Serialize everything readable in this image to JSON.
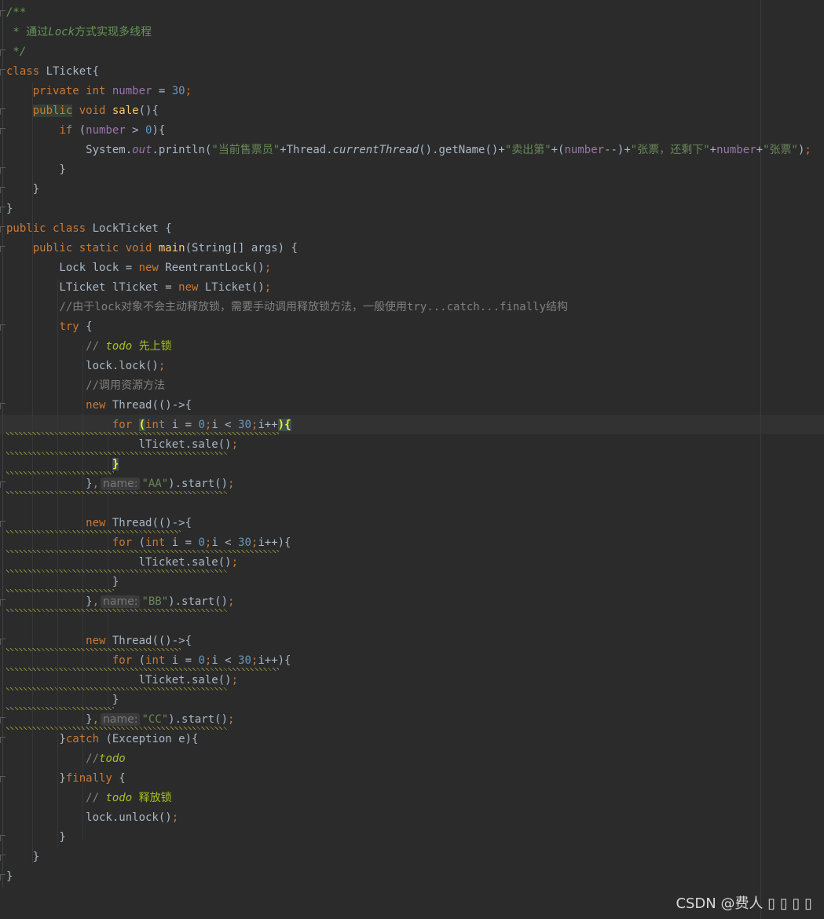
{
  "editor": {
    "lines": [
      {
        "parts": [
          [
            "doc",
            "/**"
          ]
        ]
      },
      {
        "parts": [
          [
            "docn",
            " * 通过"
          ],
          [
            "doc",
            "Lock"
          ],
          [
            "docn",
            "方式实现多线程"
          ]
        ]
      },
      {
        "parts": [
          [
            "doc",
            " */"
          ]
        ]
      },
      {
        "parts": [
          [
            "kw",
            "class "
          ],
          [
            "plain",
            "LTicket{"
          ]
        ]
      },
      {
        "parts": [
          [
            "plain",
            "    "
          ],
          [
            "kw",
            "private int "
          ],
          [
            "fld",
            "number"
          ],
          [
            "plain",
            " = "
          ],
          [
            "num",
            "30"
          ],
          [
            "kw",
            ";"
          ]
        ]
      },
      {
        "parts": [
          [
            "plain",
            "    "
          ],
          [
            "kwhl",
            "public"
          ],
          [
            "kw",
            " void "
          ],
          [
            "fn",
            "sale"
          ],
          [
            "plain",
            "(){"
          ]
        ]
      },
      {
        "parts": [
          [
            "plain",
            "        "
          ],
          [
            "kw",
            "if "
          ],
          [
            "plain",
            "("
          ],
          [
            "fld",
            "number"
          ],
          [
            "plain",
            " > "
          ],
          [
            "num",
            "0"
          ],
          [
            "plain",
            "){"
          ]
        ]
      },
      {
        "parts": [
          [
            "plain",
            "            System."
          ],
          [
            "fldi",
            "out"
          ],
          [
            "plain",
            ".println("
          ],
          [
            "str",
            "\"当前售票员\""
          ],
          [
            "plain",
            "+Thread."
          ],
          [
            "it",
            "currentThread"
          ],
          [
            "plain",
            "().getName()+"
          ],
          [
            "str",
            "\"卖出第\""
          ],
          [
            "plain",
            "+("
          ],
          [
            "fld",
            "number"
          ],
          [
            "plain",
            "--)+"
          ],
          [
            "str",
            "\"张票，还剩下\""
          ],
          [
            "plain",
            "+"
          ],
          [
            "fld",
            "number"
          ],
          [
            "plain",
            "+"
          ],
          [
            "str",
            "\"张票\""
          ],
          [
            "plain",
            ")"
          ],
          [
            "kw",
            ";"
          ]
        ]
      },
      {
        "parts": [
          [
            "plain",
            "        }"
          ]
        ]
      },
      {
        "parts": [
          [
            "plain",
            "    }"
          ]
        ]
      },
      {
        "parts": [
          [
            "plain",
            "}"
          ]
        ]
      },
      {
        "parts": [
          [
            "kw",
            "public class "
          ],
          [
            "plain",
            "LockTicket {"
          ]
        ]
      },
      {
        "parts": [
          [
            "plain",
            "    "
          ],
          [
            "kw",
            "public static void "
          ],
          [
            "fn",
            "main"
          ],
          [
            "plain",
            "(String[] args) {"
          ]
        ]
      },
      {
        "parts": [
          [
            "plain",
            "        Lock lock = "
          ],
          [
            "kw",
            "new "
          ],
          [
            "plain",
            "ReentrantLock()"
          ],
          [
            "kw",
            ";"
          ]
        ]
      },
      {
        "parts": [
          [
            "plain",
            "        LTicket lTicket = "
          ],
          [
            "kw",
            "new "
          ],
          [
            "plain",
            "LTicket()"
          ],
          [
            "kw",
            ";"
          ]
        ]
      },
      {
        "parts": [
          [
            "plain",
            "        "
          ],
          [
            "cm",
            "//由于lock对象不会主动释放锁，需要手动调用释放锁方法，一般使用try...catch...finally结构"
          ]
        ]
      },
      {
        "parts": [
          [
            "plain",
            "        "
          ],
          [
            "kw",
            "try "
          ],
          [
            "plain",
            "{"
          ]
        ]
      },
      {
        "parts": [
          [
            "plain",
            "            "
          ],
          [
            "cm",
            "// "
          ],
          [
            "todo",
            "todo"
          ],
          [
            "todot",
            " 先上锁"
          ]
        ]
      },
      {
        "parts": [
          [
            "plain",
            "            lock.lock()"
          ],
          [
            "kw",
            ";"
          ]
        ]
      },
      {
        "parts": [
          [
            "plain",
            "            "
          ],
          [
            "cm",
            "//调用资源方法"
          ]
        ]
      },
      {
        "parts": [
          [
            "plain",
            "            "
          ],
          [
            "kw",
            "new "
          ],
          [
            "plain",
            "Thread(()->{"
          ]
        ]
      },
      {
        "parts": [
          [
            "plain",
            "                "
          ],
          [
            "kw",
            "for "
          ],
          [
            "bhl",
            "("
          ],
          [
            "kw",
            "int "
          ],
          [
            "plain",
            "i = "
          ],
          [
            "num",
            "0"
          ],
          [
            "kw",
            ";"
          ],
          [
            "plain",
            "i < "
          ],
          [
            "num",
            "30"
          ],
          [
            "kw",
            ";"
          ],
          [
            "plain",
            "i++"
          ],
          [
            "bhl",
            "){"
          ]
        ]
      },
      {
        "parts": [
          [
            "plain",
            "                    lTicket.sale()"
          ],
          [
            "kw",
            ";"
          ]
        ]
      },
      {
        "parts": [
          [
            "plain",
            "                "
          ],
          [
            "bhl",
            "}"
          ]
        ]
      },
      {
        "parts": [
          [
            "plain",
            "            }"
          ],
          [
            "kw",
            ","
          ],
          [
            "hint",
            "name:"
          ],
          [
            "str",
            "\"AA\""
          ],
          [
            "plain",
            ").start()"
          ],
          [
            "kw",
            ";"
          ]
        ]
      },
      {
        "parts": [
          [
            "plain",
            ""
          ]
        ]
      },
      {
        "parts": [
          [
            "plain",
            "            "
          ],
          [
            "kw",
            "new "
          ],
          [
            "plain",
            "Thread(()->{"
          ]
        ]
      },
      {
        "parts": [
          [
            "plain",
            "                "
          ],
          [
            "kw",
            "for "
          ],
          [
            "plain",
            "("
          ],
          [
            "kw",
            "int "
          ],
          [
            "plain",
            "i = "
          ],
          [
            "num",
            "0"
          ],
          [
            "kw",
            ";"
          ],
          [
            "plain",
            "i < "
          ],
          [
            "num",
            "30"
          ],
          [
            "kw",
            ";"
          ],
          [
            "plain",
            "i++){"
          ]
        ]
      },
      {
        "parts": [
          [
            "plain",
            "                    lTicket.sale()"
          ],
          [
            "kw",
            ";"
          ]
        ]
      },
      {
        "parts": [
          [
            "plain",
            "                }"
          ]
        ]
      },
      {
        "parts": [
          [
            "plain",
            "            }"
          ],
          [
            "kw",
            ","
          ],
          [
            "hint",
            "name:"
          ],
          [
            "str",
            "\"BB\""
          ],
          [
            "plain",
            ").start()"
          ],
          [
            "kw",
            ";"
          ]
        ]
      },
      {
        "parts": [
          [
            "plain",
            ""
          ]
        ]
      },
      {
        "parts": [
          [
            "plain",
            "            "
          ],
          [
            "kw",
            "new "
          ],
          [
            "plain",
            "Thread(()->{"
          ]
        ]
      },
      {
        "parts": [
          [
            "plain",
            "                "
          ],
          [
            "kw",
            "for "
          ],
          [
            "plain",
            "("
          ],
          [
            "kw",
            "int "
          ],
          [
            "plain",
            "i = "
          ],
          [
            "num",
            "0"
          ],
          [
            "kw",
            ";"
          ],
          [
            "plain",
            "i < "
          ],
          [
            "num",
            "30"
          ],
          [
            "kw",
            ";"
          ],
          [
            "plain",
            "i++){"
          ]
        ]
      },
      {
        "parts": [
          [
            "plain",
            "                    lTicket.sale()"
          ],
          [
            "kw",
            ";"
          ]
        ]
      },
      {
        "parts": [
          [
            "plain",
            "                }"
          ]
        ]
      },
      {
        "parts": [
          [
            "plain",
            "            }"
          ],
          [
            "kw",
            ","
          ],
          [
            "hint",
            "name:"
          ],
          [
            "str",
            "\"CC\""
          ],
          [
            "plain",
            ").start()"
          ],
          [
            "kw",
            ";"
          ]
        ]
      },
      {
        "parts": [
          [
            "plain",
            "        }"
          ],
          [
            "kw",
            "catch "
          ],
          [
            "plain",
            "(Exception e){"
          ]
        ]
      },
      {
        "parts": [
          [
            "plain",
            "            "
          ],
          [
            "cm",
            "//"
          ],
          [
            "todo",
            "todo"
          ]
        ]
      },
      {
        "parts": [
          [
            "plain",
            "        }"
          ],
          [
            "kw",
            "finally "
          ],
          [
            "plain",
            "{"
          ]
        ]
      },
      {
        "parts": [
          [
            "plain",
            "            "
          ],
          [
            "cm",
            "// "
          ],
          [
            "todo",
            "todo"
          ],
          [
            "todot",
            " 释放锁"
          ]
        ]
      },
      {
        "parts": [
          [
            "plain",
            "            lock.unlock()"
          ],
          [
            "kw",
            ";"
          ]
        ]
      },
      {
        "parts": [
          [
            "plain",
            "        }"
          ]
        ]
      },
      {
        "parts": [
          [
            "plain",
            "    }"
          ]
        ]
      },
      {
        "parts": [
          [
            "plain",
            "}"
          ]
        ]
      }
    ]
  },
  "watermark": {
    "text": "CSDN @费人 ▯ ▯ ▯ ▯"
  },
  "colors": {
    "background": "#2b2b2b",
    "keyword": "#cc7832",
    "string": "#6a8759",
    "number": "#6897bb",
    "field": "#9876aa",
    "function": "#ffc66d",
    "comment": "#808080",
    "todo": "#a8c023"
  }
}
